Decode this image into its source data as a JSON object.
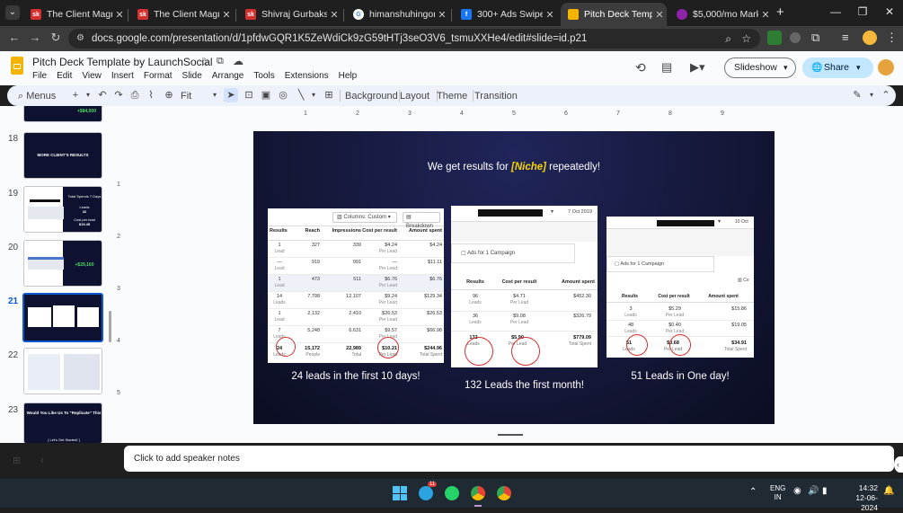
{
  "tabs": [
    {
      "label": "The Client Magnets",
      "favicon": "sk",
      "color": "#d32f2f"
    },
    {
      "label": "The Client Magnets",
      "favicon": "sk",
      "color": "#d32f2f"
    },
    {
      "label": "Shivraj Gurbakshani",
      "favicon": "sk",
      "color": "#d32f2f"
    },
    {
      "label": "himanshuhingorani.",
      "favicon": "G",
      "color": "#ffffff"
    },
    {
      "label": "300+ Ads Swipe File",
      "favicon": "f",
      "color": "#1877f2"
    },
    {
      "label": "Pitch Deck Template",
      "favicon": "",
      "color": "#f4b400"
    },
    {
      "label": "$5,000/mo Marke",
      "favicon": "",
      "color": "#8e24aa"
    }
  ],
  "url": "docs.google.com/presentation/d/1pfdwGQR1K5ZeWdiCk9zG59tHTj3seO3V6_tsmuXXHe4/edit#slide=id.p21",
  "doc": {
    "title": "Pitch Deck Template by LaunchSocial",
    "menu": [
      "File",
      "Edit",
      "View",
      "Insert",
      "Format",
      "Slide",
      "Arrange",
      "Tools",
      "Extensions",
      "Help"
    ],
    "slideshow": "Slideshow",
    "share": "Share"
  },
  "toolbar": {
    "menus": "Menus",
    "zoom": "Fit",
    "background": "Background",
    "layout": "Layout",
    "theme": "Theme",
    "transition": "Transition"
  },
  "ruler": [
    "1",
    "2",
    "3",
    "4",
    "5",
    "6",
    "7",
    "8",
    "9"
  ],
  "thumbs": [
    {
      "num": "",
      "text": "+$84,000"
    },
    {
      "num": "18",
      "text": "MORE CLIENT'S RESULTS"
    },
    {
      "num": "19",
      "text": "Total Spends 7 Days"
    },
    {
      "num": "20",
      "text": "+$29,160"
    },
    {
      "num": "21",
      "text": ""
    },
    {
      "num": "22",
      "text": ""
    },
    {
      "num": "23",
      "text": "Would You Like Us To \"Replicate\" This"
    }
  ],
  "thumb23_cta": "[ Let's Get Started! ]",
  "thumb19_sub": "Leads",
  "thumb19_sub2": "Cost per lead",
  "thumb19_val1": "32",
  "thumb19_val2": "$19.45",
  "slide": {
    "headline_pre": "We get results for ",
    "headline_niche": "[Niche]",
    "headline_post": " repeatedly!",
    "captions": [
      "24 leads in the first 10 days!",
      "132 Leads the first month!",
      "51 Leads in One day!"
    ],
    "shot1": {
      "columns_btn": "Columns: Custom",
      "breakdown": "Breakdown",
      "headers": [
        "Results",
        "Reach",
        "Impressions",
        "Cost per result",
        "Amount spent"
      ],
      "rows": [
        [
          "1",
          "Lead",
          "327",
          "339",
          "$4.24",
          "Per Lead",
          "$4.24"
        ],
        [
          "—",
          "Lead",
          "919",
          "991",
          "—",
          "Per Lead",
          "$11.11"
        ],
        [
          "1",
          "Lead",
          "473",
          "511",
          "$6.76",
          "Per Lead",
          "$6.76"
        ],
        [
          "14",
          "Leads",
          "7,798",
          "12,107",
          "$9.24",
          "Per Lead",
          "$129.34"
        ],
        [
          "1",
          "Lead",
          "2,132",
          "2,410",
          "$26.53",
          "Per Lead",
          "$26.53"
        ],
        [
          "7",
          "Leads",
          "5,248",
          "6,631",
          "$9.57",
          "Per Lead",
          "$66.98"
        ]
      ],
      "total": [
        "24",
        "Leads",
        "15,172",
        "People",
        "22,989",
        "Total",
        "$10.21",
        "Per Lead",
        "$244.96",
        "Total Spent"
      ]
    },
    "shot2": {
      "date": "7 Oct 2019",
      "campaign": "Ads for 1 Campaign",
      "headers": [
        "Results",
        "Cost per result",
        "Amount spent"
      ],
      "rows": [
        [
          "96",
          "Leads",
          "$4.71",
          "Per Lead",
          "$452.30"
        ],
        [
          "36",
          "Leads",
          "$9.08",
          "Per Lead",
          "$326.79"
        ]
      ],
      "total": [
        "132",
        "Leads",
        "$5.90",
        "Per Lead",
        "$779.09",
        "Total Spent"
      ]
    },
    "shot3": {
      "date": "10 Oct",
      "campaign": "Ads for 1 Campaign",
      "headers": [
        "Results",
        "Cost per result",
        "Amount spent"
      ],
      "rows": [
        [
          "3",
          "Leads",
          "$5.29",
          "Per Lead",
          "$15.86"
        ],
        [
          "48",
          "Leads",
          "$0.40",
          "Per Lead",
          "$19.05"
        ]
      ],
      "total": [
        "51",
        "Leads",
        "$0.68",
        "Per Lead",
        "$34.91",
        "Total Spent"
      ]
    }
  },
  "notes_placeholder": "Click to add speaker notes",
  "taskbar": {
    "lang1": "ENG",
    "lang2": "IN",
    "time": "14:32",
    "date": "12-06-2024",
    "telegram_badge": "11"
  },
  "colors": {
    "accent": "#0b57d0",
    "share_bg": "#c2e7ff",
    "niche": "#f5d400",
    "circle": "#d32f2f"
  }
}
